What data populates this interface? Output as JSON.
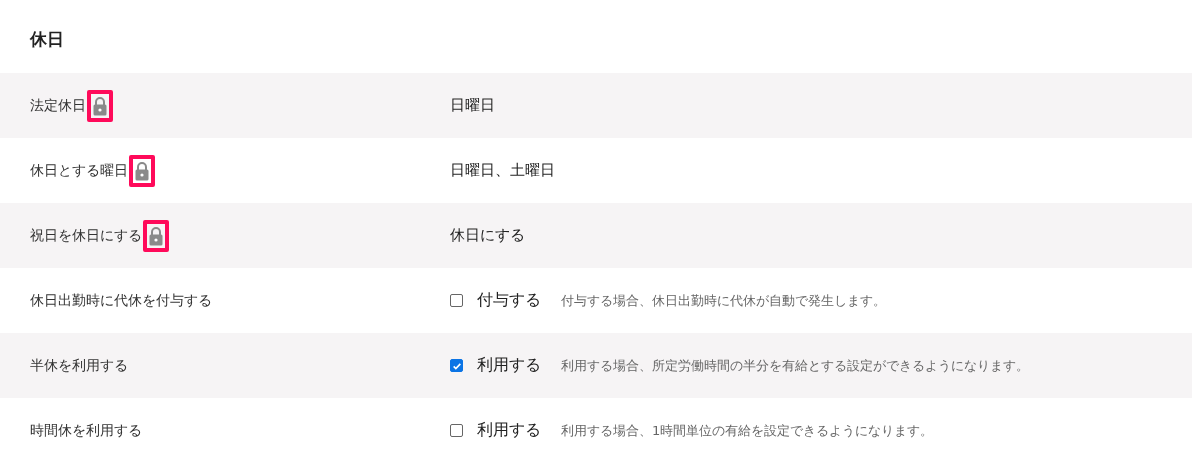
{
  "section": {
    "title": "休日"
  },
  "rows": [
    {
      "label": "法定休日",
      "locked": true,
      "highlighted": true,
      "kind": "text",
      "value": "日曜日"
    },
    {
      "label": "休日とする曜日",
      "locked": true,
      "highlighted": true,
      "kind": "text",
      "value": "日曜日、土曜日"
    },
    {
      "label": "祝日を休日にする",
      "locked": true,
      "highlighted": true,
      "kind": "text",
      "value": "休日にする"
    },
    {
      "label": "休日出勤時に代休を付与する",
      "kind": "checkbox",
      "checked": false,
      "option": "付与する",
      "hint": "付与する場合、休日出勤時に代休が自動で発生します。"
    },
    {
      "label": "半休を利用する",
      "kind": "checkbox",
      "checked": true,
      "option": "利用する",
      "hint": "利用する場合、所定労働時間の半分を有給とする設定ができるようになります。"
    },
    {
      "label": "時間休を利用する",
      "kind": "checkbox",
      "checked": false,
      "option": "利用する",
      "hint": "利用する場合、1時間単位の有給を設定できるようになります。"
    }
  ]
}
